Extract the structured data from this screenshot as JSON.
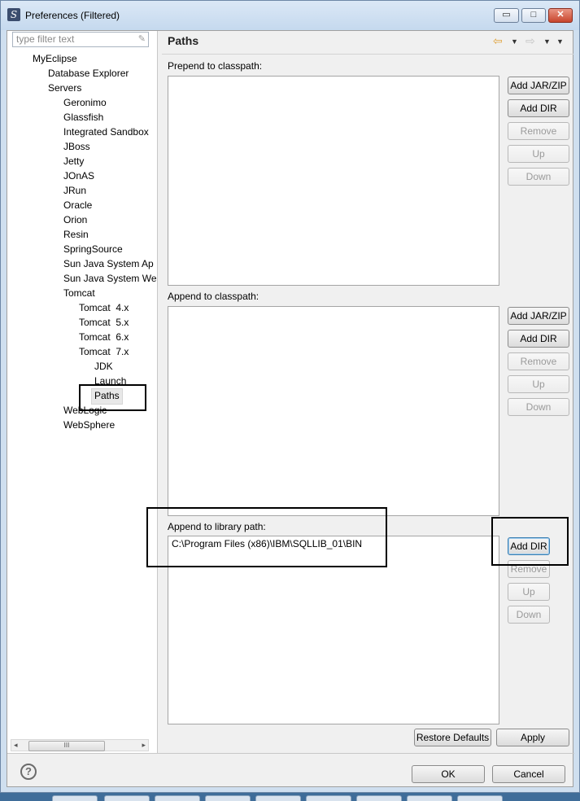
{
  "window": {
    "title": "Preferences (Filtered)",
    "controls": {
      "minimize": "▭",
      "maximize": "□",
      "close": "✕"
    }
  },
  "left_pane": {
    "filter": {
      "placeholder": "type filter text",
      "clear_icon": "✎"
    },
    "tree": [
      {
        "label": "MyEclipse"
      },
      {
        "label": "Database Explorer"
      },
      {
        "label": "Servers"
      },
      {
        "label": "Geronimo"
      },
      {
        "label": "Glassfish"
      },
      {
        "label": "Integrated Sandbox"
      },
      {
        "label": "JBoss"
      },
      {
        "label": "Jetty"
      },
      {
        "label": "JOnAS"
      },
      {
        "label": "JRun"
      },
      {
        "label": "Oracle"
      },
      {
        "label": "Orion"
      },
      {
        "label": "Resin"
      },
      {
        "label": "SpringSource"
      },
      {
        "label": "Sun Java System Ap"
      },
      {
        "label": "Sun Java System We"
      },
      {
        "label": "Tomcat"
      },
      {
        "label": "Tomcat  4.x"
      },
      {
        "label": "Tomcat  5.x"
      },
      {
        "label": "Tomcat  6.x"
      },
      {
        "label": "Tomcat  7.x"
      },
      {
        "label": "JDK"
      },
      {
        "label": "Launch"
      },
      {
        "label": "Paths"
      },
      {
        "label": "WebLogic"
      },
      {
        "label": "WebSphere"
      }
    ],
    "selected_item": "Paths",
    "scrollbar": {
      "left_arrow": "◂",
      "right_arrow": "▸",
      "grip": "III"
    }
  },
  "right_pane": {
    "title": "Paths",
    "nav": {
      "back_icon": "⇦",
      "forward_icon": "⇨",
      "dropdown_icon": "▼"
    },
    "prepend": {
      "label": "Prepend to classpath:",
      "entries": [],
      "buttons": {
        "add_jar": "Add JAR/ZIP",
        "add_dir": "Add DIR",
        "remove": "Remove",
        "up": "Up",
        "down": "Down"
      }
    },
    "append": {
      "label": "Append to classpath:",
      "entries": [],
      "buttons": {
        "add_jar": "Add JAR/ZIP",
        "add_dir": "Add DIR",
        "remove": "Remove",
        "up": "Up",
        "down": "Down"
      }
    },
    "library": {
      "label": "Append to library path:",
      "entries": [
        "C:\\Program Files (x86)\\IBM\\SQLLIB_01\\BIN"
      ],
      "buttons": {
        "add_dir": "Add DIR",
        "remove": "Remove",
        "up": "Up",
        "down": "Down"
      }
    },
    "restore_defaults": "Restore Defaults",
    "apply": "Apply"
  },
  "footer": {
    "help_icon": "?",
    "ok": "OK",
    "cancel": "Cancel"
  }
}
